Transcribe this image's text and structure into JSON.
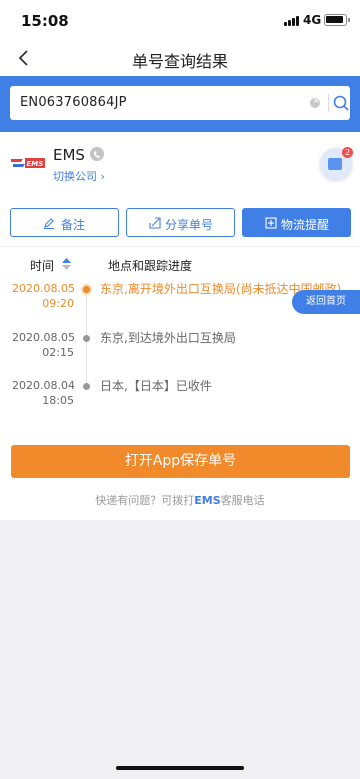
{
  "status_bar": {
    "time": "15:08",
    "network": "4G"
  },
  "nav": {
    "title": "单号查询结果"
  },
  "search": {
    "value": "EN063760864JP"
  },
  "company": {
    "name": "EMS",
    "switch_label": "切换公司 ›",
    "badge_count": "2",
    "logo_text": "EMS"
  },
  "actions": {
    "note_label": "备注",
    "share_label": "分享单号",
    "remind_label": "物流提醒"
  },
  "timeline": {
    "col_time": "时间",
    "col_location": "地点和跟踪进度",
    "events": [
      {
        "date": "2020.08.05",
        "time": "09:20",
        "desc": "东京,离开境外出口互换局(尚未抵达中国邮政)"
      },
      {
        "date": "2020.08.05",
        "time": "02:15",
        "desc": "东京,到达境外出口互换局"
      },
      {
        "date": "2020.08.04",
        "time": "18:05",
        "desc": "日本,【日本】已收件"
      }
    ]
  },
  "back_home_label": "返回首页",
  "save_button_label": "打开App保存单号",
  "hint": {
    "prefix": "快递有问题？可拨打",
    "brand": "EMS",
    "suffix": "客服电话"
  },
  "colors": {
    "accent": "#3f7fe6",
    "orange": "#f08a2b"
  }
}
